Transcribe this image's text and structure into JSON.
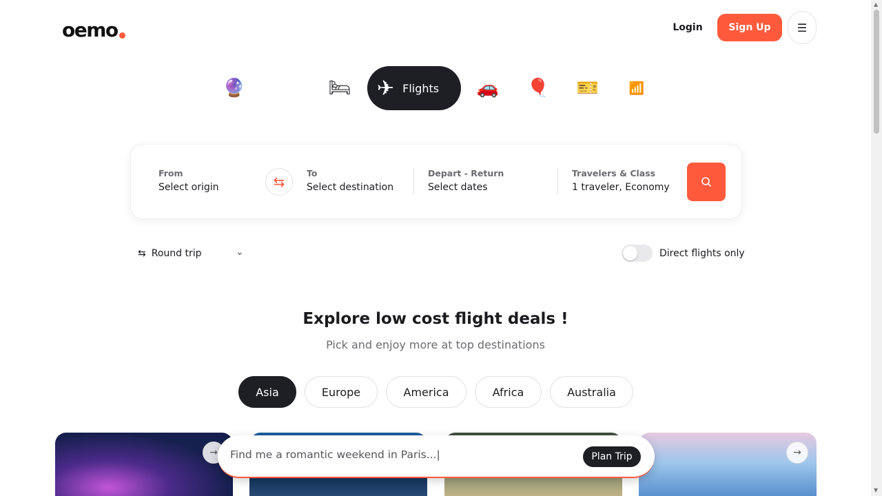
{
  "header": {
    "logo_text": "oemo",
    "login_label": "Login",
    "signup_label": "Sign Up",
    "menu_icon": "hamburger-icon",
    "accent_color": "#ff5a3c"
  },
  "categories": [
    {
      "name": "ai-trip-planner",
      "icon": "crystal-ball-icon",
      "glyph": "🔮"
    },
    {
      "name": "hotels",
      "icon": "bed-icon",
      "glyph": "🛏"
    },
    {
      "name": "flights",
      "icon": "airplane-icon",
      "glyph": "✈",
      "label": "Flights",
      "active": true
    },
    {
      "name": "cars",
      "icon": "car-icon",
      "glyph": "🚗"
    },
    {
      "name": "experiences",
      "icon": "hot-air-balloon-icon",
      "glyph": "🎈"
    },
    {
      "name": "tickets",
      "icon": "ticket-icon",
      "glyph": "🎫"
    },
    {
      "name": "esim",
      "icon": "sim-card-icon",
      "glyph": "📶"
    }
  ],
  "search": {
    "from_label": "From",
    "from_value": "Select origin",
    "to_label": "To",
    "to_value": "Select destination",
    "dates_label": "Depart - Return",
    "dates_value": "Select dates",
    "travelers_label": "Travelers & Class",
    "travelers_value": "1 traveler, Economy",
    "swap_icon": "swap-arrows-icon",
    "search_icon": "search-icon"
  },
  "options": {
    "trip_type": "Round trip",
    "direct_flights_label": "Direct flights only",
    "direct_flights_on": false
  },
  "deals": {
    "title": "Explore low cost flight deals !",
    "subtitle": "Pick and enjoy more at top destinations",
    "regions": [
      "Asia",
      "Europe",
      "America",
      "Africa",
      "Australia"
    ],
    "active_region": "Asia"
  },
  "prompt": {
    "placeholder": "Find me a romantic weekend in Paris...|",
    "button_label": "Plan Trip"
  }
}
